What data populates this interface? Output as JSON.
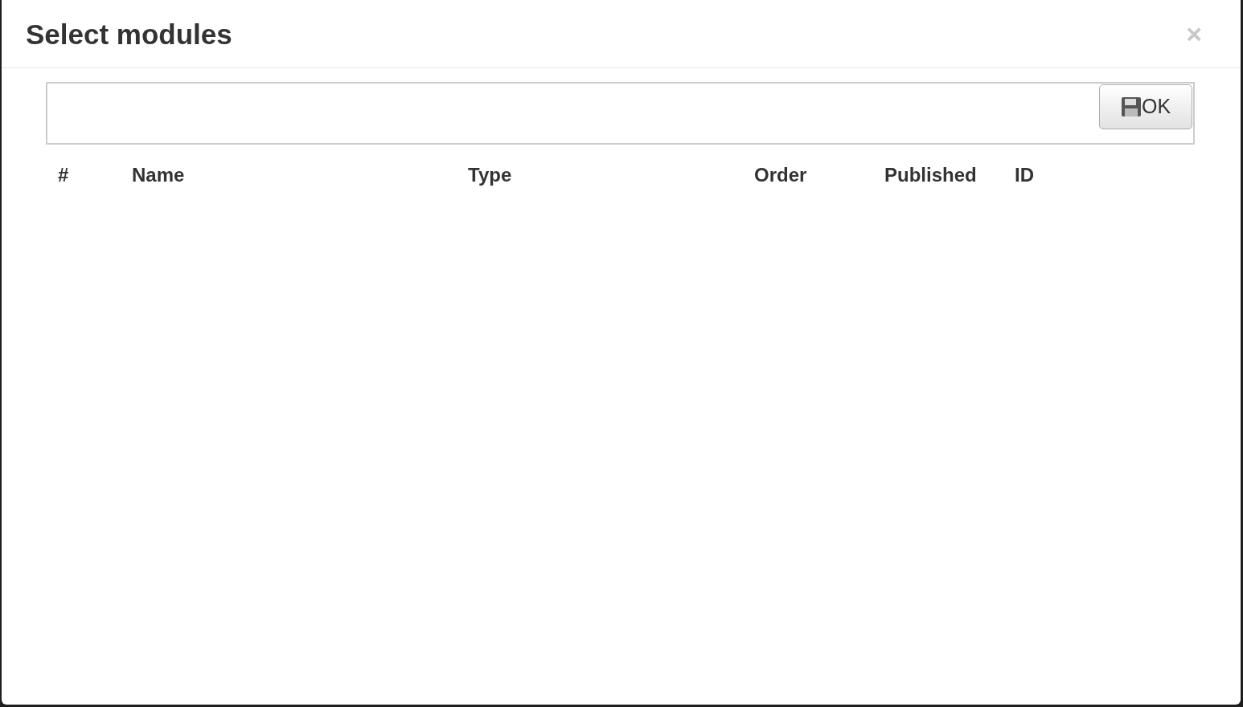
{
  "dialog": {
    "title": "Select modules",
    "close": "×"
  },
  "toolbar": {
    "ok_button": "OK"
  },
  "table": {
    "columns": [
      "#",
      "Name",
      "Type",
      "Order",
      "Published",
      "ID"
    ]
  }
}
